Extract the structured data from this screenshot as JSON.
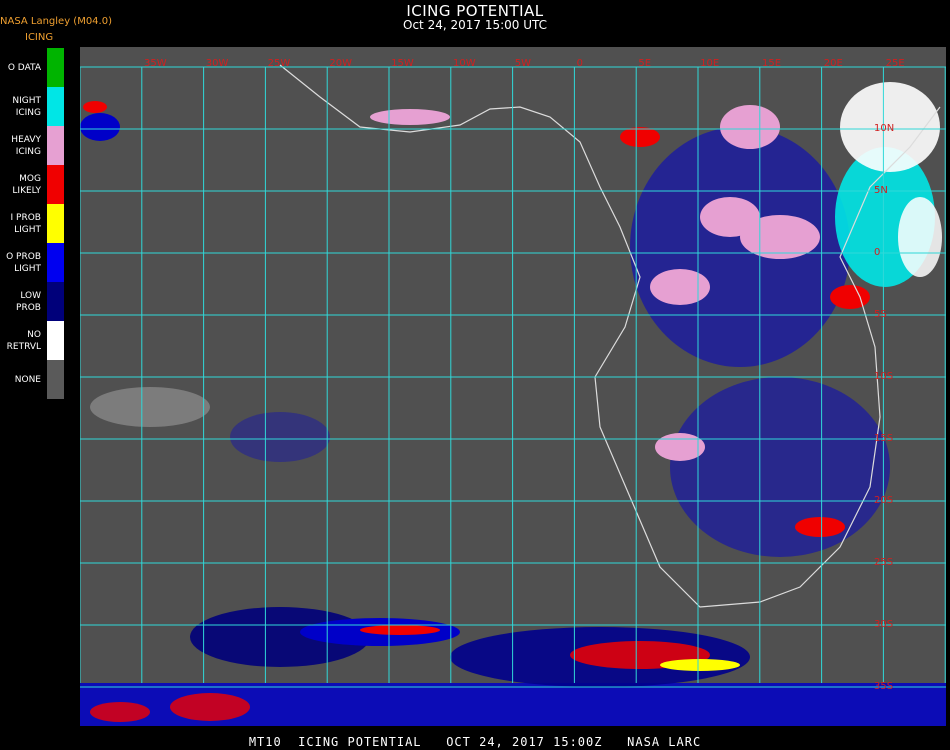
{
  "header": {
    "title": "ICING POTENTIAL",
    "subtitle": "Oct 24, 2017 15:00 UTC",
    "producer": "NASA Langley (M04.0)",
    "product": "ICING"
  },
  "legend": [
    {
      "label": "O DATA",
      "color": "#00b400"
    },
    {
      "label": "NIGHT\nICING",
      "color": "#00e6e6"
    },
    {
      "label": "HEAVY\nICING",
      "color": "#e6a0d2"
    },
    {
      "label": "MOG\nLIKELY",
      "color": "#f00000"
    },
    {
      "label": "I PROB\nLIGHT",
      "color": "#ffff00"
    },
    {
      "label": "O PROB\nLIGHT",
      "color": "#0000f0"
    },
    {
      "label": "LOW\nPROB",
      "color": "#00007a"
    },
    {
      "label": "NO\nRETRVL",
      "color": "#ffffff"
    },
    {
      "label": "NONE",
      "color": "#5a5a5a"
    }
  ],
  "map": {
    "background_color": "#505050",
    "grid_color": "#30d8d8",
    "label_color": "#d02020",
    "top_labels": [
      "35W",
      "30W",
      "25W",
      "20W",
      "15W",
      "10W",
      "5W",
      "0",
      "5E",
      "10E",
      "15E",
      "20E",
      "25E",
      "30E",
      "35E"
    ],
    "right_labels": [
      "10N",
      "5N",
      "0",
      "5S",
      "10S",
      "15S",
      "20S",
      "25S",
      "30S",
      "35S",
      "40S"
    ]
  },
  "footer": {
    "text": "MT10  ICING POTENTIAL   OCT 24, 2017 15:00Z   NASA LARC"
  }
}
